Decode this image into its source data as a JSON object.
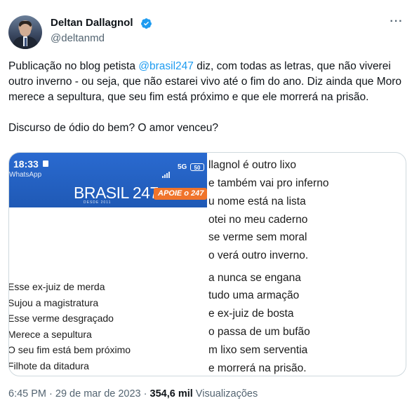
{
  "author": {
    "display_name": "Deltan Dallagnol",
    "handle": "@deltanmd",
    "verified_icon": "verified-badge-icon",
    "more_label": "···"
  },
  "tweet": {
    "text_before_mention": "Publicação no blog petista ",
    "mention": "@brasil247",
    "text_after_mention": " diz, com todas as letras, que não viverei outro inverno - ou seja, que não estarei vivo até o fim do ano. Diz ainda que Moro merece a sepultura, que seu fim está próximo e que ele morrerá na prisão.",
    "second_paragraph": "Discurso de ódio do bem? O amor venceu?"
  },
  "media": {
    "phone_time": "18:33",
    "phone_app": "WhatsApp",
    "network": "5G",
    "battery": "50",
    "brand_text": "BRASIL 247",
    "brand_sub": "DESDE 2011",
    "apoie_label": "APOIE o 247",
    "left_lines": [
      "Esse ex-juiz de merda",
      "Sujou a magistratura",
      "Esse verme desgraçado",
      "Merece a sepultura",
      "O seu fim está bem próximo",
      "Filhote da ditadura"
    ],
    "right_lines": [
      "llagnol é outro lixo",
      "e também vai pro inferno",
      "u nome está na lista",
      "otei no meu caderno",
      "se verme sem moral",
      "o verá outro inverno.",
      "a nunca se engana",
      "tudo uma armação",
      "e ex-juiz de bosta",
      "o passa de um bufão",
      "m lixo sem serventia",
      "e morrerá na prisão."
    ]
  },
  "meta": {
    "time": "6:45 PM",
    "separator1": " · ",
    "date": "29 de mar de 2023",
    "separator2": " · ",
    "views_count": "354,6 mil",
    "views_label": " Visualizações"
  },
  "colors": {
    "accent": "#1d9bf0",
    "text": "#0f1419",
    "secondary": "#536471",
    "brand_blue": "#1f59b5",
    "apoie_orange": "#f0742b"
  }
}
